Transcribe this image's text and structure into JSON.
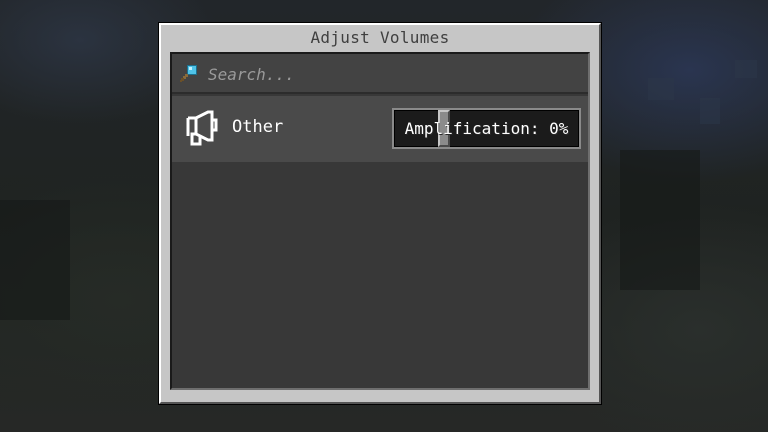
{
  "window": {
    "title": "Adjust Volumes"
  },
  "search": {
    "placeholder": "Search...",
    "value": "",
    "icon": "magnifying-glass-icon"
  },
  "entries": [
    {
      "label": "Other",
      "icon": "megaphone-icon",
      "slider": {
        "text": "Amplification: 0%",
        "value_percent": 0
      }
    }
  ],
  "colors": {
    "window_bg": "#c6c6c6",
    "panel_bg": "#383838",
    "row_bg": "#4a4a4a",
    "search_icon_lens": "#4fc3e8",
    "text": "#ffffff"
  }
}
